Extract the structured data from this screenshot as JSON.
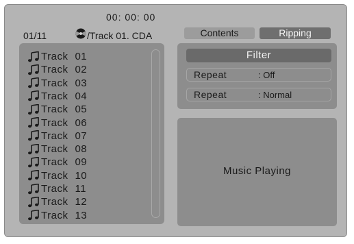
{
  "player": {
    "elapsed_time": "00: 00: 00",
    "track_position": "01/11",
    "file_path": "/Track 01. CDA",
    "disc_icon": "disc-icon"
  },
  "tabs": [
    {
      "label": "Contents",
      "active": false
    },
    {
      "label": "Ripping",
      "active": true
    }
  ],
  "playlist": {
    "item_icon": "music-note-icon",
    "items": [
      {
        "label": "Track",
        "number": "01"
      },
      {
        "label": "Track",
        "number": "02"
      },
      {
        "label": "Track",
        "number": "03"
      },
      {
        "label": "Track",
        "number": "04"
      },
      {
        "label": "Track",
        "number": "05"
      },
      {
        "label": "Track",
        "number": "06"
      },
      {
        "label": "Track",
        "number": "07"
      },
      {
        "label": "Track",
        "number": "08"
      },
      {
        "label": "Track",
        "number": "09"
      },
      {
        "label": "Track",
        "number": "10"
      },
      {
        "label": "Track",
        "number": "11"
      },
      {
        "label": "Track",
        "number": "12"
      },
      {
        "label": "Track",
        "number": "13"
      }
    ]
  },
  "options": {
    "filter_label": "Filter",
    "repeat_one": {
      "label": "Repeat",
      "value": ": Off"
    },
    "repeat_two": {
      "label": "Repeat",
      "value": ": Normal"
    }
  },
  "status": {
    "message": "Music Playing"
  },
  "colors": {
    "background": "#b4b4b4",
    "panel": "#8d8d8d",
    "tab_active": "#6f6f6f",
    "tab_inactive": "#9c9c9c"
  }
}
